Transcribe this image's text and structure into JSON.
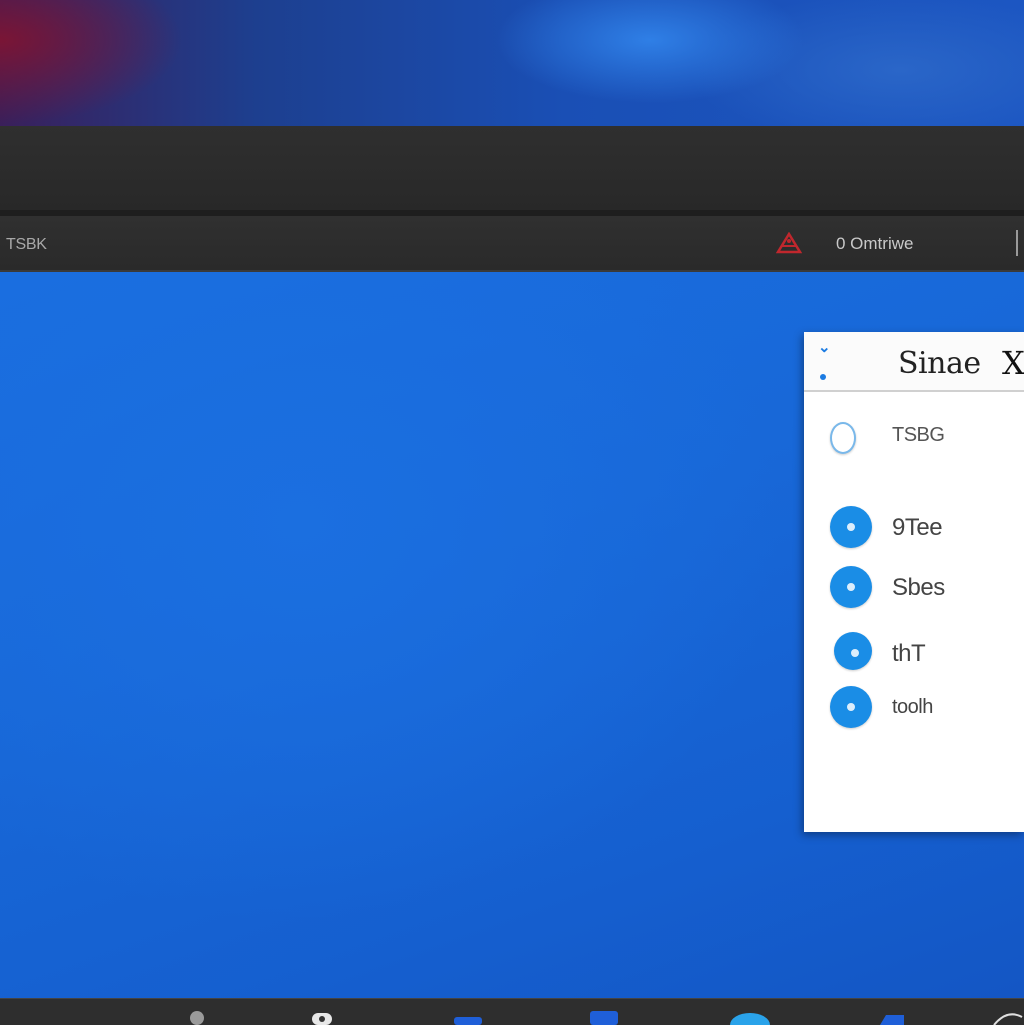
{
  "window": {
    "title": "TSBK",
    "status_text": "0 Omtriwe",
    "alert_icon": "alert-icon"
  },
  "panel": {
    "title": "Sinae",
    "close_label": "X",
    "items": [
      {
        "label": "TSBG",
        "icon": "user-icon"
      },
      {
        "label": "9Tee",
        "icon": "circle-icon"
      },
      {
        "label": "Sbes",
        "icon": "circle-icon"
      },
      {
        "label": "thT",
        "icon": "circle-icon"
      },
      {
        "label": "toolh",
        "icon": "circle-icon"
      }
    ]
  },
  "taskbar": {
    "icons": [
      "settings-icon",
      "camera-icon",
      "app-icon",
      "app-icon",
      "browser-icon",
      "app-icon",
      "search-icon"
    ]
  },
  "colors": {
    "accent": "#1a8de6",
    "desktop": "#1868d8",
    "titlebar": "#2c2c2c"
  }
}
